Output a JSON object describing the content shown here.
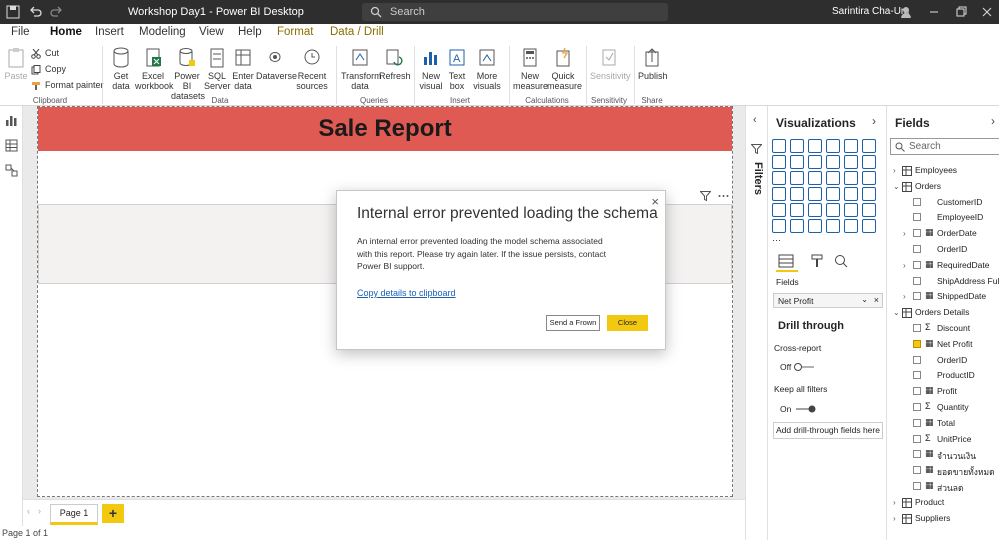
{
  "title_bar": {
    "document_title": "Workshop Day1 - Power BI Desktop",
    "search_placeholder": "Search",
    "user_name": "Sarintira Cha-Um"
  },
  "menu": {
    "tabs": [
      "File",
      "Home",
      "Insert",
      "Modeling",
      "View",
      "Help",
      "Format",
      "Data / Drill"
    ],
    "active": "Home"
  },
  "ribbon": {
    "clipboard": {
      "paste": "Paste",
      "cut": "Cut",
      "copy": "Copy",
      "format_painter": "Format painter",
      "group": "Clipboard"
    },
    "data": {
      "get_data": "Get data",
      "excel": "Excel workbook",
      "pbi_datasets": "Power BI datasets",
      "sql": "SQL Server",
      "enter_data": "Enter data",
      "dataverse": "Dataverse",
      "recent": "Recent sources",
      "group": "Data"
    },
    "queries": {
      "transform": "Transform data",
      "refresh": "Refresh",
      "group": "Queries"
    },
    "insert": {
      "new_visual": "New visual",
      "text_box": "Text box",
      "more_visuals": "More visuals",
      "group": "Insert"
    },
    "calculations": {
      "new_measure": "New measure",
      "quick_measure": "Quick measure",
      "group": "Calculations"
    },
    "sensitivity": {
      "label": "Sensitivity",
      "group": "Sensitivity"
    },
    "share": {
      "publish": "Publish",
      "group": "Share"
    }
  },
  "report": {
    "banner_title": "Sale Report",
    "page_tab": "Page 1",
    "add_page": "+",
    "status": "Page 1 of 1"
  },
  "filters_pane": {
    "label": "Filters"
  },
  "visualizations": {
    "header": "Visualizations",
    "fields_label": "Fields",
    "field_well_value": "Net Profit",
    "drill_through": "Drill through",
    "cross_report": "Cross-report",
    "cross_report_state": "Off",
    "keep_all_filters": "Keep all filters",
    "keep_state": "On",
    "add_fields_button": "Add drill-through fields here"
  },
  "fields_pane": {
    "header": "Fields",
    "search_placeholder": "Search",
    "rows": [
      {
        "label": "Employees",
        "type": "table",
        "expanded": false
      },
      {
        "label": "Orders",
        "type": "table",
        "expanded": true
      },
      {
        "label": "CustomerID",
        "type": "field",
        "checked": false
      },
      {
        "label": "EmployeeID",
        "type": "field",
        "checked": false
      },
      {
        "label": "OrderDate",
        "type": "date",
        "checked": false
      },
      {
        "label": "OrderID",
        "type": "field",
        "checked": false
      },
      {
        "label": "RequiredDate",
        "type": "date",
        "checked": false
      },
      {
        "label": "ShipAddress Full",
        "type": "field",
        "checked": false
      },
      {
        "label": "ShippedDate",
        "type": "date",
        "checked": false
      },
      {
        "label": "Orders Details",
        "type": "table",
        "expanded": true
      },
      {
        "label": "Discount",
        "type": "sigma",
        "checked": false
      },
      {
        "label": "Net Profit",
        "type": "measure",
        "checked": true
      },
      {
        "label": "OrderID",
        "type": "field",
        "checked": false
      },
      {
        "label": "ProductID",
        "type": "field",
        "checked": false
      },
      {
        "label": "Profit",
        "type": "measure",
        "checked": false
      },
      {
        "label": "Quantity",
        "type": "sigma",
        "checked": false
      },
      {
        "label": "Total",
        "type": "measure",
        "checked": false
      },
      {
        "label": "UnitPrice",
        "type": "sigma",
        "checked": false
      },
      {
        "label": "จำนวนเงิน",
        "type": "measure",
        "checked": false
      },
      {
        "label": "ยอดขายทั้งหมด",
        "type": "measure",
        "checked": false
      },
      {
        "label": "ส่วนลด",
        "type": "measure",
        "checked": false
      },
      {
        "label": "Product",
        "type": "table",
        "expanded": false
      },
      {
        "label": "Suppliers",
        "type": "table",
        "expanded": false
      }
    ]
  },
  "dialog": {
    "title": "Internal error prevented loading the schema",
    "message": "An internal error prevented loading the model schema associated with this report. Please try again later. If the issue persists, contact Power BI support.",
    "link": "Copy details to clipboard",
    "send_frown": "Send a Frown",
    "close": "Close",
    "close_icon": "×"
  },
  "colors": {
    "accent": "#f2c811",
    "banner": "#e05a54",
    "titlebar": "#2e2e2e"
  }
}
